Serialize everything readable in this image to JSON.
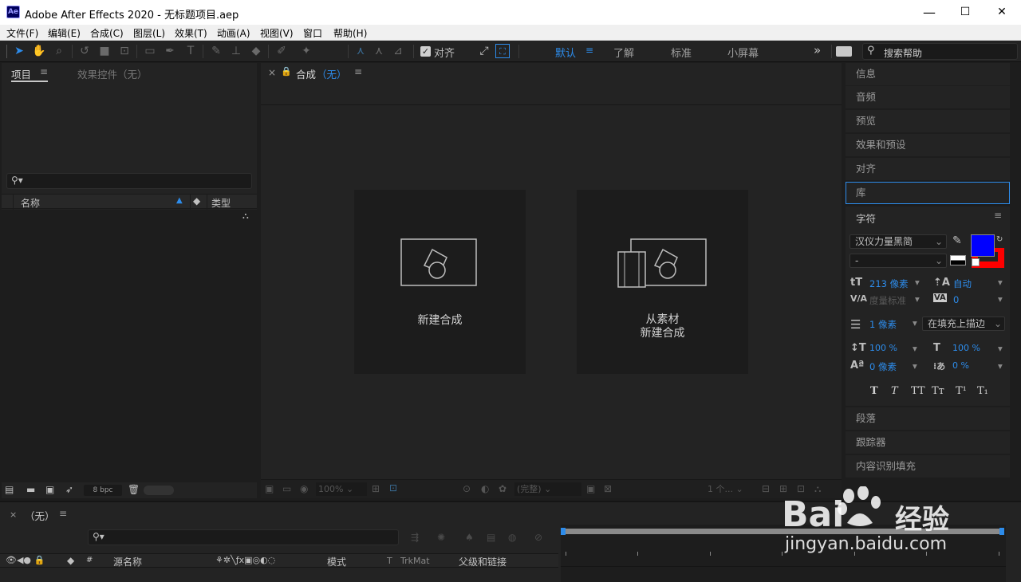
{
  "window": {
    "logo": "Ae",
    "title": "Adobe After Effects 2020 - 无标题项目.aep",
    "minimize": "—",
    "maximize": "☐",
    "close": "✕"
  },
  "menu": [
    "文件(F)",
    "编辑(E)",
    "合成(C)",
    "图层(L)",
    "效果(T)",
    "动画(A)",
    "视图(V)",
    "窗口",
    "帮助(H)"
  ],
  "toolbar": {
    "align_label": "对齐",
    "workspaces": [
      "默认",
      "了解",
      "标准",
      "小屏幕"
    ],
    "overflow": "»",
    "search_placeholder": "搜索帮助"
  },
  "project": {
    "tab_project": "项目",
    "tab_effects": "效果控件（无）",
    "col_name": "名称",
    "col_type": "类型",
    "bpc": "8 bpc"
  },
  "comp": {
    "close": "×",
    "tab_label": "合成",
    "tab_value": "（无）",
    "new_comp": "新建合成",
    "from_footage_line1": "从素材",
    "from_footage_line2": "新建合成",
    "zoom": "100%",
    "quality": "(完整)",
    "views": "1 个..."
  },
  "right_panels": {
    "info": "信息",
    "audio": "音频",
    "preview": "预览",
    "effects_presets": "效果和预设",
    "align": "对齐",
    "library": "库",
    "character": "字符",
    "paragraph": "段落",
    "tracker": "跟踪器",
    "content_aware": "内容识别填充"
  },
  "character": {
    "font": "汉仪力量黑简",
    "style": "-",
    "size": "213 像素",
    "leading": "自动",
    "kerning": "度量标准",
    "tracking": "0",
    "stroke_width": "1 像素",
    "stroke_mode": "在填充上描边",
    "vscale": "100 %",
    "hscale": "100 %",
    "baseline": "0 像素",
    "tsume": "0 %",
    "fill_color": "#0000ff",
    "stroke_color": "#ff0000",
    "styles": [
      "T",
      "T",
      "TT",
      "Tт",
      "T¹",
      "T₁"
    ]
  },
  "timeline": {
    "close": "×",
    "tab": "（无）",
    "col_source": "源名称",
    "col_mode": "模式",
    "col_t": "T",
    "col_trkmat": "TrkMat",
    "col_parent": "父级和链接"
  },
  "watermark": {
    "brand": "Bai",
    "brand_suffix": "经验",
    "url": "jingyan.baidu.com"
  }
}
